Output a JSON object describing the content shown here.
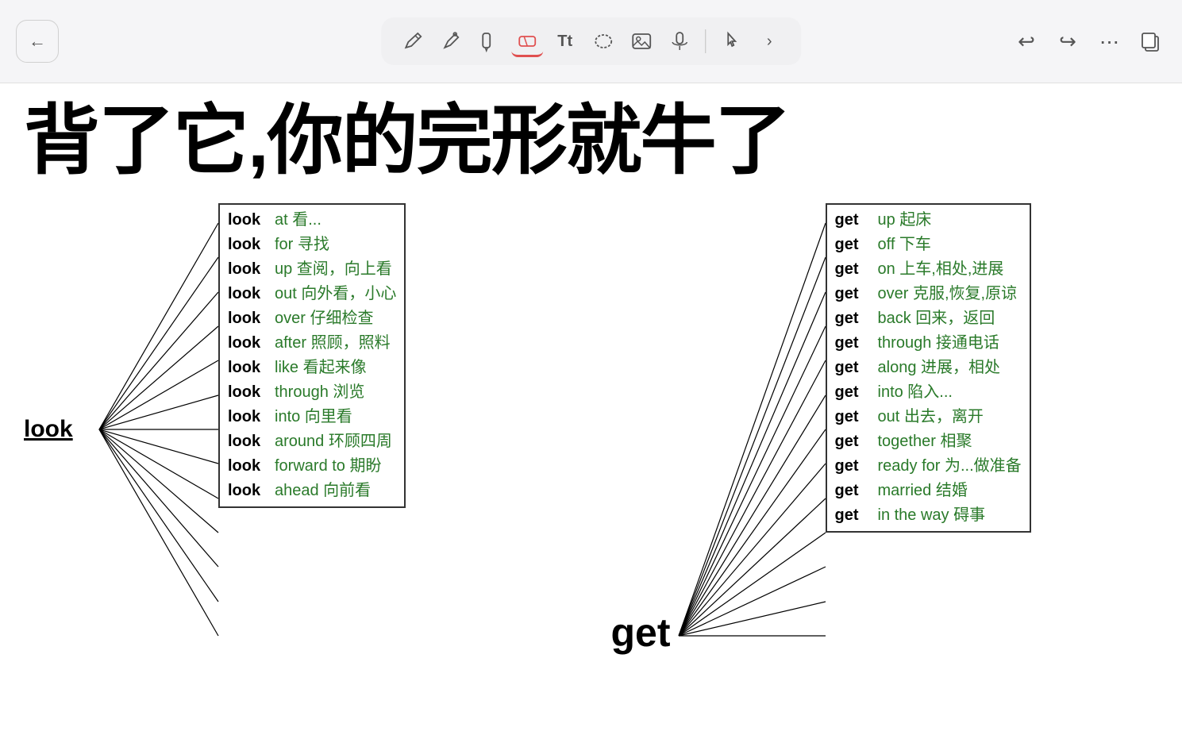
{
  "toolbar": {
    "back_label": "←",
    "tools": [
      {
        "name": "pencil",
        "icon": "✏️",
        "active": false
      },
      {
        "name": "pen",
        "icon": "🖊",
        "active": false
      },
      {
        "name": "marker",
        "icon": "🖍",
        "active": false
      },
      {
        "name": "eraser",
        "icon": "⬜",
        "active": true
      },
      {
        "name": "text",
        "icon": "Tt",
        "active": false
      },
      {
        "name": "lasso",
        "icon": "⭕",
        "active": false
      },
      {
        "name": "image",
        "icon": "🖼",
        "active": false
      },
      {
        "name": "mic",
        "icon": "🎤",
        "active": false
      },
      {
        "name": "hand",
        "icon": "👆",
        "active": false
      },
      {
        "name": "more",
        "icon": "›",
        "active": false
      }
    ],
    "right_tools": [
      {
        "name": "undo",
        "icon": "↩"
      },
      {
        "name": "redo",
        "icon": "↪"
      },
      {
        "name": "dots",
        "icon": "•••"
      },
      {
        "name": "copy",
        "icon": "⧉"
      }
    ]
  },
  "title": "背了它,你的完形就牛了",
  "left_anchor": "look",
  "left_items": [
    {
      "word": "look",
      "phrase": "at 看..."
    },
    {
      "word": "look",
      "phrase": "for 寻找"
    },
    {
      "word": "look",
      "phrase": "up 查阅，向上看"
    },
    {
      "word": "look",
      "phrase": "out 向外看，小心"
    },
    {
      "word": "look",
      "phrase": "over 仔细检查"
    },
    {
      "word": "look",
      "phrase": "after 照顾，照料"
    },
    {
      "word": "look",
      "phrase": "like 看起来像"
    },
    {
      "word": "look",
      "phrase": "through 浏览"
    },
    {
      "word": "look",
      "phrase": "into 向里看"
    },
    {
      "word": "look",
      "phrase": "around 环顾四周"
    },
    {
      "word": "look",
      "phrase": "forward to 期盼"
    },
    {
      "word": "look",
      "phrase": "ahead 向前看"
    }
  ],
  "right_anchor": "get",
  "right_items": [
    {
      "word": "get",
      "phrase": "up 起床"
    },
    {
      "word": "get",
      "phrase": "off 下车"
    },
    {
      "word": "get",
      "phrase": "on 上车,相处,进展"
    },
    {
      "word": "get",
      "phrase": "over 克服,恢复,原谅"
    },
    {
      "word": "get",
      "phrase": "back 回来，返回"
    },
    {
      "word": "get",
      "phrase": "through 接通电话"
    },
    {
      "word": "get",
      "phrase": "along 进展，相处"
    },
    {
      "word": "get",
      "phrase": "into 陷入..."
    },
    {
      "word": "get",
      "phrase": "out 出去，离开"
    },
    {
      "word": "get",
      "phrase": "together 相聚"
    },
    {
      "word": "get",
      "phrase": "ready for 为...做准备"
    },
    {
      "word": "get",
      "phrase": "married 结婚"
    },
    {
      "word": "get",
      "phrase": "in the way 碍事"
    }
  ]
}
